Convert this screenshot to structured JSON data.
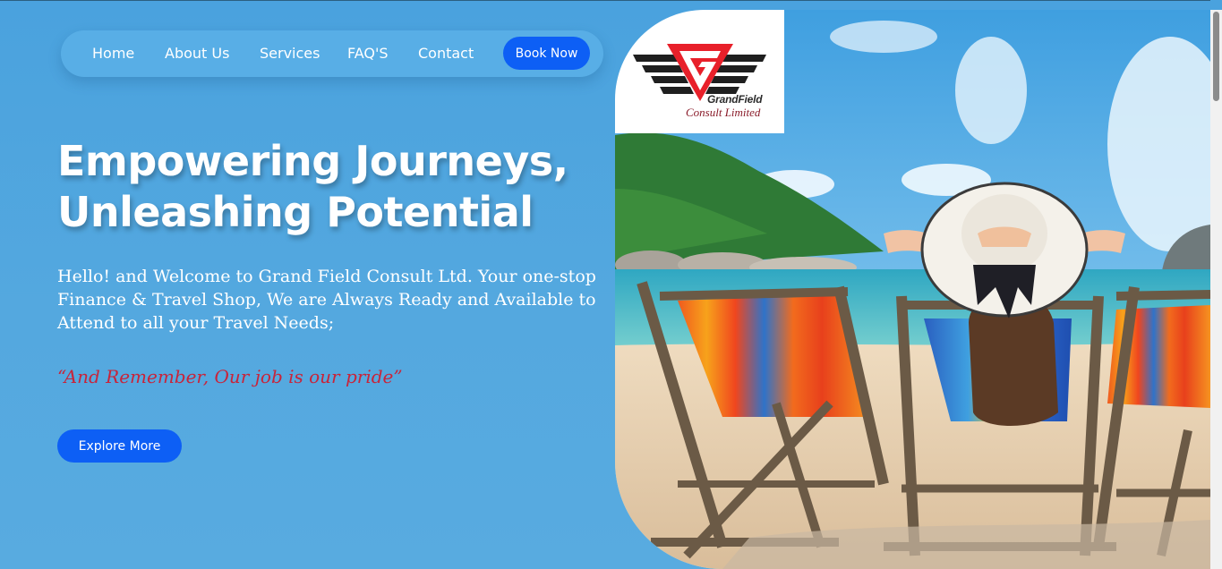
{
  "nav": {
    "items": [
      {
        "label": "Home"
      },
      {
        "label": "About Us"
      },
      {
        "label": "Services"
      },
      {
        "label": "FAQ'S"
      },
      {
        "label": "Contact"
      }
    ],
    "book_label": "Book Now"
  },
  "hero": {
    "headline_line1": "Empowering Journeys,",
    "headline_line2": "Unleashing Potential",
    "intro": "Hello! and Welcome to Grand Field Consult Ltd. Your one-stop Finance & Travel Shop, We are Always Ready and Available to Attend to all your Travel Needs;",
    "tagline": "“And Remember, Our job is our pride”",
    "explore_label": "Explore More"
  },
  "logo": {
    "name": "GrandField",
    "subtitle": "Consult Limited",
    "icon": "g-wings-logo"
  },
  "image": {
    "icon": "beach-photo"
  },
  "colors": {
    "background": "#4aa2de",
    "button": "#0d5ff5",
    "tagline": "#c8243a",
    "logo_red": "#e8202a"
  }
}
